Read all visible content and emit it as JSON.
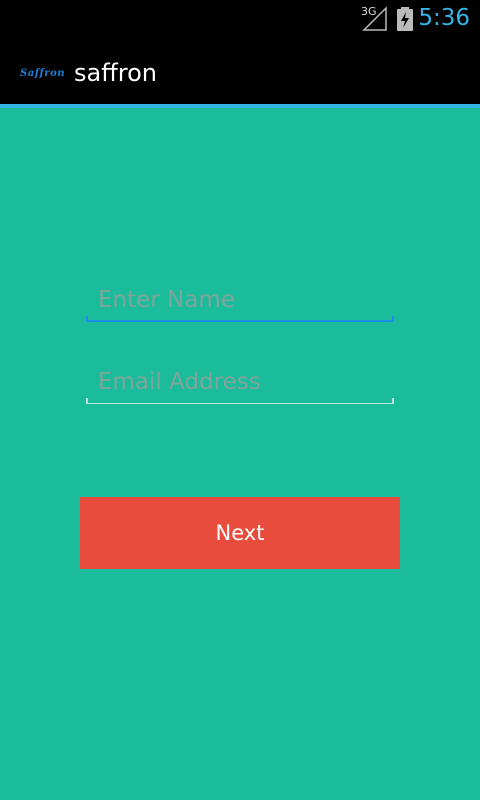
{
  "status_bar": {
    "network": "3G",
    "time": "5:36"
  },
  "action_bar": {
    "logo_text": "Saffron",
    "title": "saffron"
  },
  "form": {
    "name_field": {
      "placeholder": "Enter Name",
      "value": ""
    },
    "email_field": {
      "placeholder": "Email Address",
      "value": ""
    },
    "next_label": "Next"
  },
  "colors": {
    "background": "#1abc9c",
    "button": "#e74c3c",
    "accent": "#33b5e5",
    "focus_underline": "#1d8ee6"
  },
  "icons": [
    "signal-icon",
    "battery-charging-icon"
  ]
}
